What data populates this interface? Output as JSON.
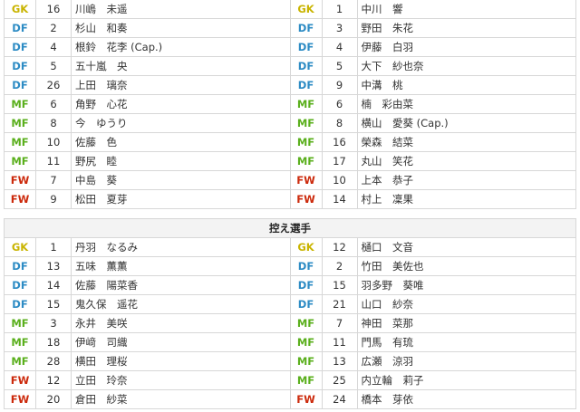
{
  "colors": {
    "GK": "#c9b400",
    "DF": "#2c8bc4",
    "MF": "#5aaf1c",
    "FW": "#cc2a0c",
    "border": "#d7d7d7"
  },
  "starters": [
    {
      "left": {
        "pos": "GK",
        "num": "16",
        "name": "川嶋　未遥"
      },
      "right": {
        "pos": "GK",
        "num": "1",
        "name": "中川　響"
      }
    },
    {
      "left": {
        "pos": "DF",
        "num": "2",
        "name": "杉山　和奏"
      },
      "right": {
        "pos": "DF",
        "num": "3",
        "name": "野田　朱花"
      }
    },
    {
      "left": {
        "pos": "DF",
        "num": "4",
        "name": "根鈴　花李 (Cap.)"
      },
      "right": {
        "pos": "DF",
        "num": "4",
        "name": "伊藤　白羽"
      }
    },
    {
      "left": {
        "pos": "DF",
        "num": "5",
        "name": "五十嵐　央"
      },
      "right": {
        "pos": "DF",
        "num": "5",
        "name": "大下　紗也奈"
      }
    },
    {
      "left": {
        "pos": "DF",
        "num": "26",
        "name": "上田　璃奈"
      },
      "right": {
        "pos": "DF",
        "num": "9",
        "name": "中溝　桃"
      }
    },
    {
      "left": {
        "pos": "MF",
        "num": "6",
        "name": "角野　心花"
      },
      "right": {
        "pos": "MF",
        "num": "6",
        "name": "楠　彩由菜"
      }
    },
    {
      "left": {
        "pos": "MF",
        "num": "8",
        "name": "今　ゆうり"
      },
      "right": {
        "pos": "MF",
        "num": "8",
        "name": "横山　愛葵 (Cap.)"
      }
    },
    {
      "left": {
        "pos": "MF",
        "num": "10",
        "name": "佐藤　色"
      },
      "right": {
        "pos": "MF",
        "num": "16",
        "name": "榮森　結菜"
      }
    },
    {
      "left": {
        "pos": "MF",
        "num": "11",
        "name": "野尻　睦"
      },
      "right": {
        "pos": "MF",
        "num": "17",
        "name": "丸山　笑花"
      }
    },
    {
      "left": {
        "pos": "FW",
        "num": "7",
        "name": "中島　葵"
      },
      "right": {
        "pos": "FW",
        "num": "10",
        "name": "上本　恭子"
      }
    },
    {
      "left": {
        "pos": "FW",
        "num": "9",
        "name": "松田　夏芽"
      },
      "right": {
        "pos": "FW",
        "num": "14",
        "name": "村上　凜果"
      }
    }
  ],
  "subs_header": "控え選手",
  "substitutes": [
    {
      "left": {
        "pos": "GK",
        "num": "1",
        "name": "丹羽　なるみ"
      },
      "right": {
        "pos": "GK",
        "num": "12",
        "name": "樋口　文音"
      }
    },
    {
      "left": {
        "pos": "DF",
        "num": "13",
        "name": "五味　薫薫"
      },
      "right": {
        "pos": "DF",
        "num": "2",
        "name": "竹田　美佐也"
      }
    },
    {
      "left": {
        "pos": "DF",
        "num": "14",
        "name": "佐藤　陽菜香"
      },
      "right": {
        "pos": "DF",
        "num": "15",
        "name": "羽多野　葵唯"
      }
    },
    {
      "left": {
        "pos": "DF",
        "num": "15",
        "name": "鬼久保　遥花"
      },
      "right": {
        "pos": "DF",
        "num": "21",
        "name": "山口　紗奈"
      }
    },
    {
      "left": {
        "pos": "MF",
        "num": "3",
        "name": "永井　美咲"
      },
      "right": {
        "pos": "MF",
        "num": "7",
        "name": "神田　菜那"
      }
    },
    {
      "left": {
        "pos": "MF",
        "num": "18",
        "name": "伊﨑　司織"
      },
      "right": {
        "pos": "MF",
        "num": "11",
        "name": "門馬　有琉"
      }
    },
    {
      "left": {
        "pos": "MF",
        "num": "28",
        "name": "横田　理桜"
      },
      "right": {
        "pos": "MF",
        "num": "13",
        "name": "広瀬　涼羽"
      }
    },
    {
      "left": {
        "pos": "FW",
        "num": "12",
        "name": "立田　玲奈"
      },
      "right": {
        "pos": "MF",
        "num": "25",
        "name": "内立輪　莉子"
      }
    },
    {
      "left": {
        "pos": "FW",
        "num": "20",
        "name": "倉田　紗菜"
      },
      "right": {
        "pos": "FW",
        "num": "24",
        "name": "橋本　芽依"
      }
    }
  ]
}
